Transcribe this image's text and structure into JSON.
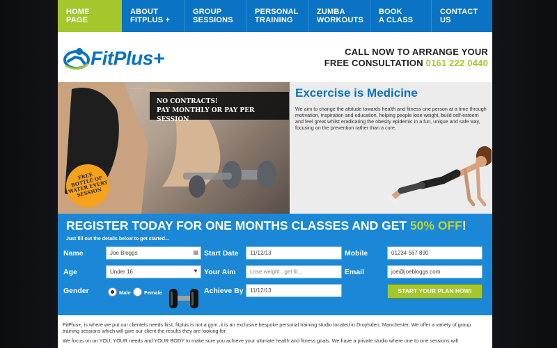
{
  "nav": {
    "items": [
      {
        "l1": "HOME",
        "l2": "PAGE"
      },
      {
        "l1": "ABOUT",
        "l2": "FITPLUS +"
      },
      {
        "l1": "GROUP",
        "l2": "SESSIONS"
      },
      {
        "l1": "PERSONAL",
        "l2": "TRAINING"
      },
      {
        "l1": "ZUMBA",
        "l2": "WORKOUTS"
      },
      {
        "l1": "BOOK",
        "l2": "A CLASS"
      },
      {
        "l1": "CONTACT",
        "l2": "US"
      }
    ]
  },
  "header": {
    "logo_text": "FitPlus+",
    "call_line1": "CALL NOW TO ARRANGE YOUR",
    "call_line2": "FREE CONSULTATION",
    "phone": "0161 222 0440"
  },
  "hero": {
    "promo_line1": "NO CONTRACTS!",
    "promo_line2": "PAY MONTHLY OR PAY PER SESSION",
    "badge_l1": "FREE",
    "badge_l2": "BOTTLE OF",
    "badge_l3": "WATER EVERY",
    "badge_l4": "SESSION",
    "title": "Excercise is Medicine",
    "text": "We aim to change the attitude towards health and fitness one person at a time through motivation, inspiration and education, helping people lose weight, build self-esteem and feel great whilst eradicating the obesity epidemic in a fun, unique and safe way, focusing on the prevention rather than a cure."
  },
  "register": {
    "title_pre": "REGISTER TODAY FOR ONE MONTHS CLASSES AND GET ",
    "title_hl": "50% OFF",
    "title_post": "!",
    "subtitle": "Just fill out the details below to get started...",
    "name_label": "Name",
    "name_value": "Joe Bloggs",
    "start_label": "Start Date",
    "start_value": "11/12/13",
    "mobile_label": "Mobile",
    "mobile_value": "01234 567 890",
    "age_label": "Age",
    "age_value": "Under 16",
    "aim_label": "Your Aim",
    "aim_value": "Lose weight...get fit...",
    "email_label": "Email",
    "email_value": "joe@joebloggs.com",
    "gender_label": "Gender",
    "male_label": "Male",
    "female_label": "Female",
    "achieve_label": "Achieve By",
    "achieve_value": "11/12/13",
    "button": "START YOUR PLAN NOW!"
  },
  "body": {
    "p1": "FitPlus+, is where we put our clientels needs first, fitplus is not a gym ,it is an exclusive bespoke personal training studio located in Droylsden, Manchester. We offer a variety of group training sessions which will give our client the results they are looking for.",
    "p2": "We focus on on YOU, YOUR needs and YOUR BODY to make sure you achieve your ultimate health and fitness goals. We have a private studio where one to one sessions will"
  },
  "colors": {
    "nav_blue": "#0a73c3",
    "active_green": "#a6c72c",
    "register_blue": "#1a88d6",
    "badge_orange": "#f7a21b"
  }
}
